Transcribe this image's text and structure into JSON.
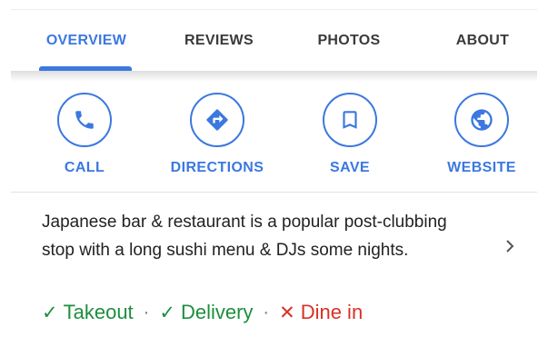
{
  "tabs": [
    {
      "label": "OVERVIEW",
      "active": true
    },
    {
      "label": "REVIEWS",
      "active": false
    },
    {
      "label": "PHOTOS",
      "active": false
    },
    {
      "label": "ABOUT",
      "active": false
    }
  ],
  "actions": [
    {
      "label": "CALL",
      "icon": "phone-icon"
    },
    {
      "label": "DIRECTIONS",
      "icon": "directions-icon"
    },
    {
      "label": "SAVE",
      "icon": "bookmark-icon"
    },
    {
      "label": "WEBSITE",
      "icon": "globe-icon"
    }
  ],
  "description": "Japanese bar & restaurant is a popular post-clubbing stop with a long sushi menu & DJs some nights.",
  "services": [
    {
      "label": "Takeout",
      "available": true,
      "mark": "✓"
    },
    {
      "label": "Delivery",
      "available": true,
      "mark": "✓"
    },
    {
      "label": "Dine in",
      "available": false,
      "mark": "✕"
    }
  ],
  "separator": "·",
  "colors": {
    "accent": "#3b78e0",
    "available": "#1e8e3e",
    "unavailable": "#d93025",
    "text": "#222222"
  }
}
